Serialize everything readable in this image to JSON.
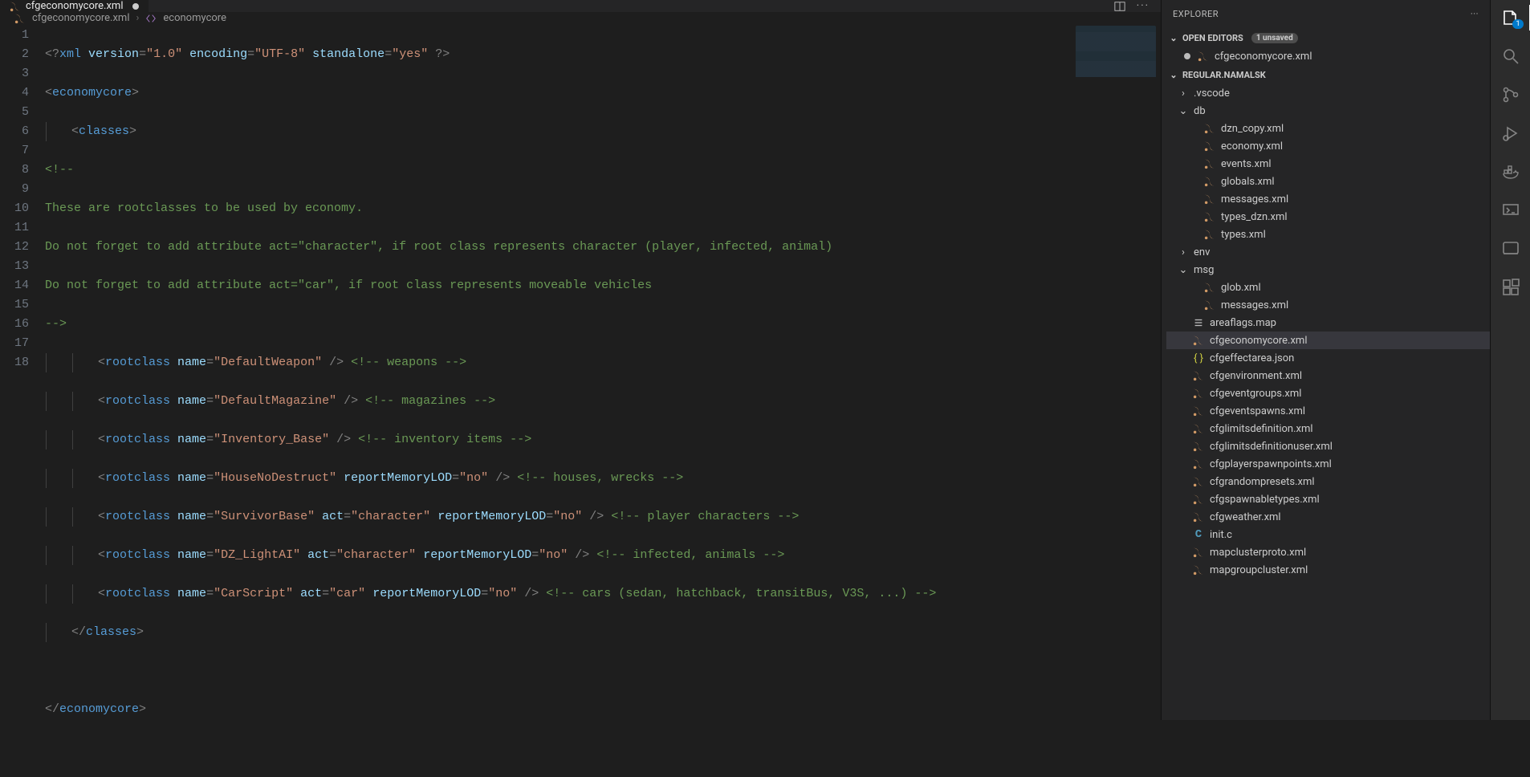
{
  "tab": {
    "name": "cfgeconomycore.xml"
  },
  "breadcrumb": {
    "file": "cfgeconomycore.xml",
    "node": "economycore"
  },
  "lines": 18,
  "code": {
    "l1": {
      "pre": "<?",
      "pi": "xml",
      "sp": " ",
      "a1": "version",
      "v1": "\"1.0\"",
      "a2": "encoding",
      "v2": "\"UTF-8\"",
      "a3": "standalone",
      "v3": "\"yes\"",
      "end": " ?>"
    },
    "l2": {
      "o": "<",
      "t": "economycore",
      "c": ">"
    },
    "l3": {
      "o": "<",
      "t": "classes",
      "c": ">"
    },
    "l4": "<!--",
    "l5": "These are rootclasses to be used by economy.",
    "l6": "Do not forget to add attribute act=\"character\", if root class represents character (player, infected, animal)",
    "l7": "Do not forget to add attribute act=\"car\", if root class represents moveable vehicles",
    "l8": "-->",
    "l9": {
      "t": "rootclass",
      "a1": "name",
      "v1": "\"DefaultWeapon\"",
      "cmt": "<!-- weapons -->"
    },
    "l10": {
      "t": "rootclass",
      "a1": "name",
      "v1": "\"DefaultMagazine\"",
      "cmt": "<!-- magazines -->"
    },
    "l11": {
      "t": "rootclass",
      "a1": "name",
      "v1": "\"Inventory_Base\"",
      "cmt": "<!-- inventory items -->"
    },
    "l12": {
      "t": "rootclass",
      "a1": "name",
      "v1": "\"HouseNoDestruct\"",
      "a2": "reportMemoryLOD",
      "v2": "\"no\"",
      "cmt": "<!-- houses, wrecks -->"
    },
    "l13": {
      "t": "rootclass",
      "a1": "name",
      "v1": "\"SurvivorBase\"",
      "a2": "act",
      "v2": "\"character\"",
      "a3": "reportMemoryLOD",
      "v3": "\"no\"",
      "cmt": "<!-- player characters -->"
    },
    "l14": {
      "t": "rootclass",
      "a1": "name",
      "v1": "\"DZ_LightAI\"",
      "a2": "act",
      "v2": "\"character\"",
      "a3": "reportMemoryLOD",
      "v3": "\"no\"",
      "cmt": "<!-- infected, animals -->"
    },
    "l15": {
      "t": "rootclass",
      "a1": "name",
      "v1": "\"CarScript\"",
      "a2": "act",
      "v2": "\"car\"",
      "a3": "reportMemoryLOD",
      "v3": "\"no\"",
      "cmt": "<!-- cars (sedan, hatchback, transitBus, V3S, ...) -->"
    },
    "l16": {
      "o": "</",
      "t": "classes",
      "c": ">"
    },
    "l18": {
      "o": "</",
      "t": "economycore",
      "c": ">"
    }
  },
  "explorer": {
    "title": "EXPLORER",
    "openEditors": "OPEN EDITORS",
    "unsaved": "1 unsaved",
    "openFile": "cfgeconomycore.xml",
    "workspace": "REGULAR.NAMALSK",
    "folders": {
      "vscode": ".vscode",
      "db": "db",
      "env": "env",
      "msg": "msg"
    },
    "db": [
      "dzn_copy.xml",
      "economy.xml",
      "events.xml",
      "globals.xml",
      "messages.xml",
      "types_dzn.xml",
      "types.xml"
    ],
    "msg": [
      "glob.xml",
      "messages.xml"
    ],
    "root": [
      {
        "n": "areaflags.map",
        "t": "map"
      },
      {
        "n": "cfgeconomycore.xml",
        "t": "xml",
        "sel": true
      },
      {
        "n": "cfgeffectarea.json",
        "t": "json"
      },
      {
        "n": "cfgenvironment.xml",
        "t": "xml"
      },
      {
        "n": "cfgeventgroups.xml",
        "t": "xml"
      },
      {
        "n": "cfgeventspawns.xml",
        "t": "xml"
      },
      {
        "n": "cfglimitsdefinition.xml",
        "t": "xml"
      },
      {
        "n": "cfglimitsdefinitionuser.xml",
        "t": "xml"
      },
      {
        "n": "cfgplayerspawnpoints.xml",
        "t": "xml"
      },
      {
        "n": "cfgrandompresets.xml",
        "t": "xml"
      },
      {
        "n": "cfgspawnabletypes.xml",
        "t": "xml"
      },
      {
        "n": "cfgweather.xml",
        "t": "xml"
      },
      {
        "n": "init.c",
        "t": "c"
      },
      {
        "n": "mapclusterproto.xml",
        "t": "xml"
      },
      {
        "n": "mapgroupcluster.xml",
        "t": "xml"
      }
    ]
  },
  "activity": {
    "badge": "1"
  }
}
